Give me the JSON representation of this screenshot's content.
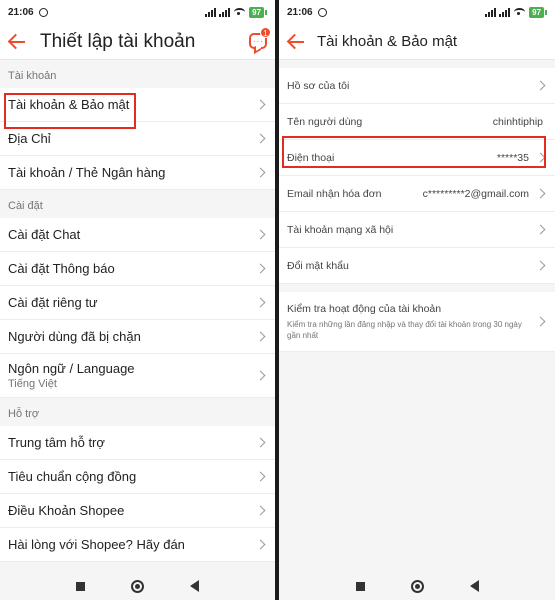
{
  "status": {
    "time": "21:06",
    "battery": "97"
  },
  "left": {
    "title": "Thiết lập tài khoản",
    "chat_badge": "1",
    "sections": [
      {
        "header": "Tài khoản",
        "items": [
          {
            "label": "Tài khoản & Bảo mật"
          },
          {
            "label": "Địa Chỉ"
          },
          {
            "label": "Tài khoản / Thẻ Ngân hàng"
          }
        ]
      },
      {
        "header": "Cài đặt",
        "items": [
          {
            "label": "Cài đặt Chat"
          },
          {
            "label": "Cài đặt Thông báo"
          },
          {
            "label": "Cài đặt riêng tư"
          },
          {
            "label": "Người dùng đã bị chặn"
          },
          {
            "label": "Ngôn ngữ / Language",
            "sub": "Tiếng Việt"
          }
        ]
      },
      {
        "header": "Hỗ trợ",
        "items": [
          {
            "label": "Trung tâm hỗ trợ"
          },
          {
            "label": "Tiêu chuẩn cộng đồng"
          },
          {
            "label": "Điều Khoản Shopee"
          },
          {
            "label": "Hài lòng với Shopee? Hãy đán"
          }
        ]
      }
    ]
  },
  "right": {
    "title": "Tài khoản & Bảo mật",
    "items": [
      {
        "label": "Hồ sơ của tôi",
        "value": ""
      },
      {
        "label": "Tên người dùng",
        "value": "chinhtiphip"
      },
      {
        "label": "Điện thoại",
        "value": "*****35"
      },
      {
        "label": "Email nhận hóa đơn",
        "value": "c*********2@gmail.com"
      },
      {
        "label": "Tài khoản mạng xã hội",
        "value": ""
      },
      {
        "label": "Đổi mật khẩu",
        "value": ""
      }
    ],
    "activity": {
      "label": "Kiểm tra hoạt động của tài khoản",
      "sub": "Kiểm tra những lần đăng nhập và thay đổi tài khoản trong 30 ngày gần nhất"
    }
  },
  "colors": {
    "accent": "#ee4d2d",
    "highlight": "#e52b20"
  }
}
